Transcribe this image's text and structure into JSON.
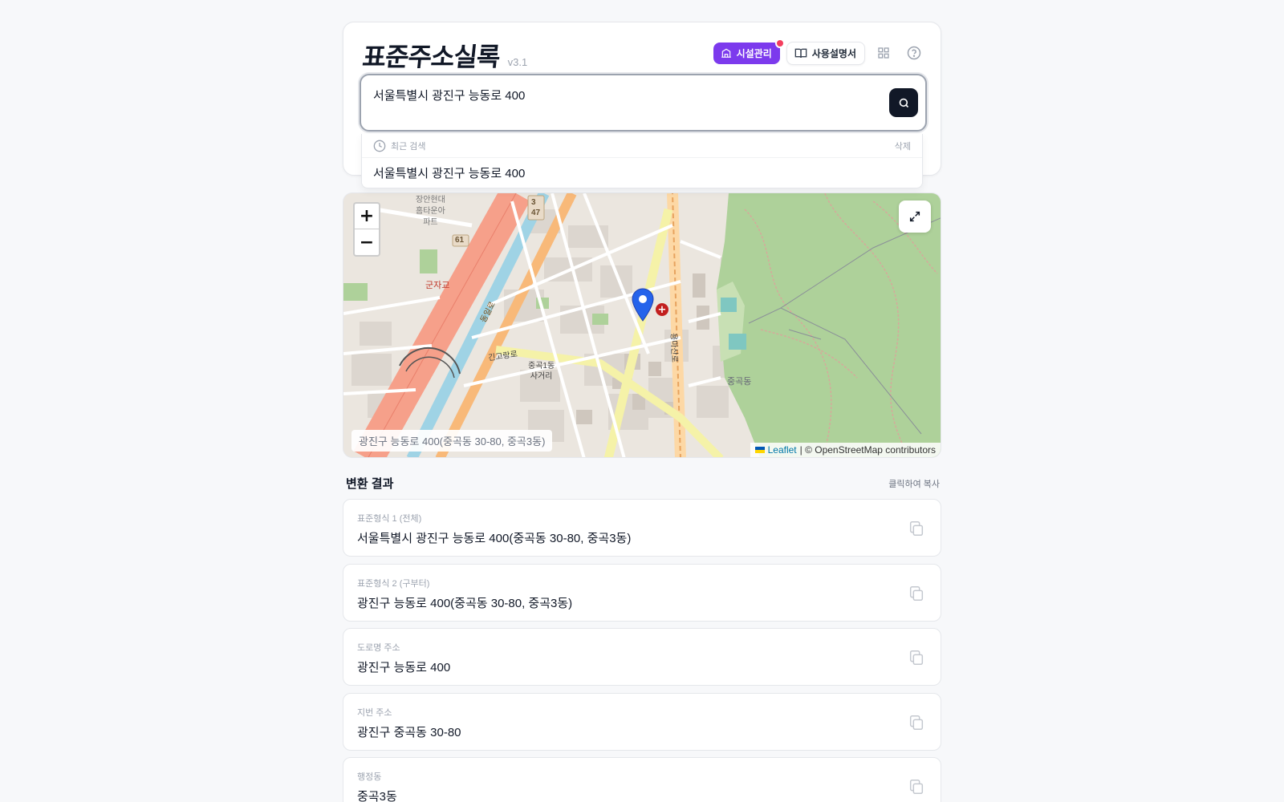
{
  "app": {
    "title": "표준주소실록",
    "version": "v3.1",
    "facility_button": "시설관리",
    "manual_button": "사용설명서"
  },
  "search": {
    "value": "서울특별시 광진구 능동로 400"
  },
  "recent": {
    "header": "최근 검색",
    "clear": "삭제",
    "items": [
      "서울특별시 광진구 능동로 400"
    ]
  },
  "map": {
    "zoom_in": "+",
    "zoom_out": "−",
    "location_label": "광진구 능동로 400(중곡동 30-80, 중곡3동)",
    "attribution_leaflet": "Leaflet",
    "attribution_osm": "| © OpenStreetMap contributors",
    "place_labels": {
      "apt": "장안현대\n홈타운아\n파트",
      "gunja_bridge": "군자교",
      "junggok": "중곡동",
      "dongil": "동일로",
      "gingoranglo": "긴고랑로",
      "junggok1": "중곡1동\n사거리",
      "yongmasan": "용마산로",
      "route61": "61",
      "route3": "3\n47"
    }
  },
  "results": {
    "title": "변환 결과",
    "hint": "클릭하여 복사",
    "items": [
      {
        "label": "표준형식 1 (전체)",
        "value": "서울특별시 광진구 능동로 400(중곡동 30-80, 중곡3동)"
      },
      {
        "label": "표준형식 2 (구부터)",
        "value": "광진구 능동로 400(중곡동 30-80, 중곡3동)"
      },
      {
        "label": "도로명 주소",
        "value": "광진구 능동로 400"
      },
      {
        "label": "지번 주소",
        "value": "광진구 중곡동 30-80"
      },
      {
        "label": "행정동",
        "value": "중곡3동"
      }
    ]
  },
  "colors": {
    "accent": "#7c3aed",
    "notification": "#f43f5e",
    "dark_button": "#111827",
    "map_pin": "#2563eb",
    "park": "#aed19a"
  }
}
